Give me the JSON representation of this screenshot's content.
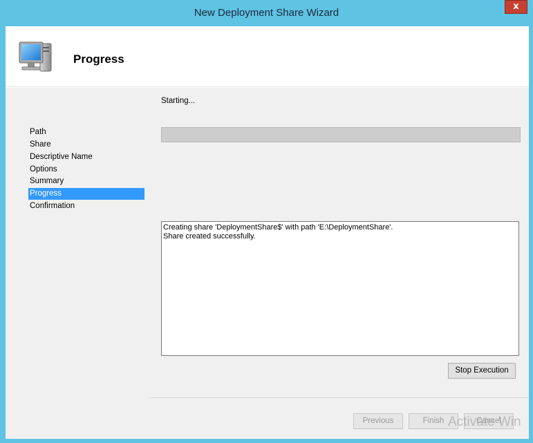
{
  "window": {
    "title": "New Deployment Share Wizard",
    "close_glyph": "x"
  },
  "header": {
    "title": "Progress",
    "icon": "computer-icon"
  },
  "sidebar": {
    "items": [
      {
        "label": "Path"
      },
      {
        "label": "Share"
      },
      {
        "label": "Descriptive Name"
      },
      {
        "label": "Options"
      },
      {
        "label": "Summary"
      },
      {
        "label": "Progress"
      },
      {
        "label": "Confirmation"
      }
    ],
    "active_index": 5
  },
  "main": {
    "status": "Starting...",
    "progress_fraction": 0,
    "log_lines": [
      "Creating share 'DeploymentShare$' with path 'E:\\DeploymentShare'.",
      "Share created successfully."
    ],
    "stop_label": "Stop Execution"
  },
  "footer": {
    "previous_label": "Previous",
    "finish_label": "Finish",
    "cancel_label": "Cancel"
  },
  "watermark": {
    "text": "Activate Win"
  },
  "colors": {
    "titlebar": "#5fc3e4",
    "selection": "#3399ff",
    "close": "#c84031"
  }
}
